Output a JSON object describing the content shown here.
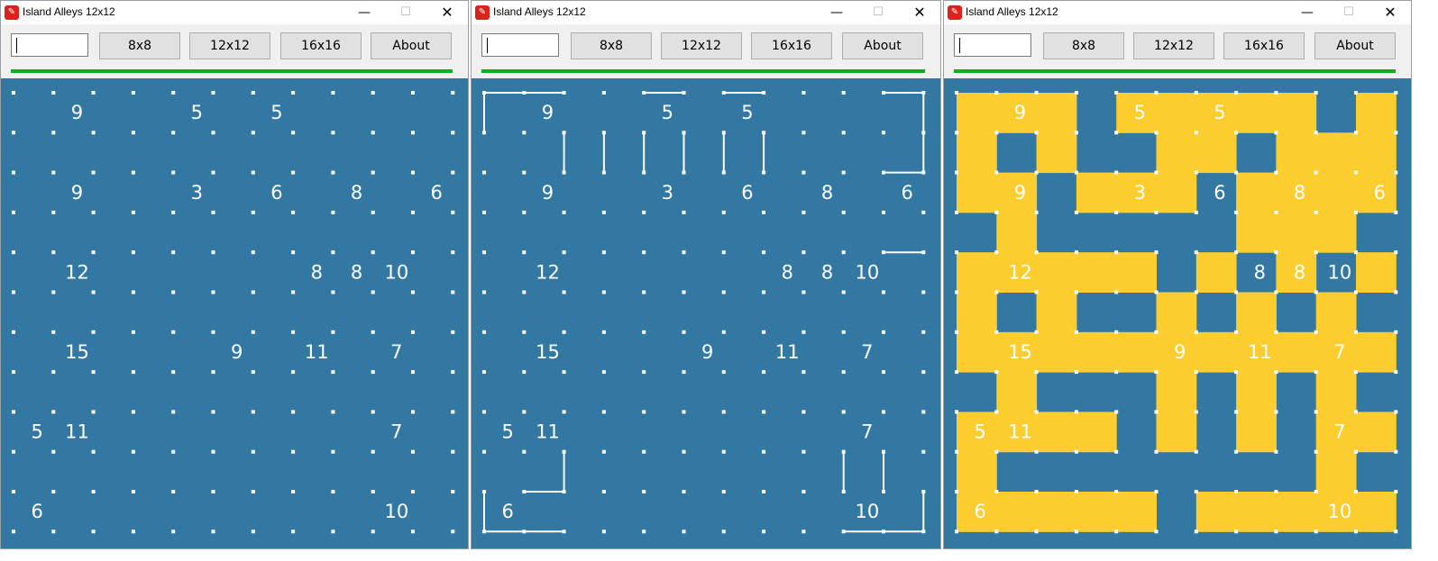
{
  "colors": {
    "board": "#3377a3",
    "island": "#fccd2f",
    "line": "#ffffff",
    "progress": "#06b025"
  },
  "clues": [
    {
      "r": 0,
      "c": 1,
      "v": "9"
    },
    {
      "r": 0,
      "c": 4,
      "v": "5"
    },
    {
      "r": 0,
      "c": 6,
      "v": "5"
    },
    {
      "r": 2,
      "c": 1,
      "v": "9"
    },
    {
      "r": 2,
      "c": 4,
      "v": "3"
    },
    {
      "r": 2,
      "c": 6,
      "v": "6"
    },
    {
      "r": 2,
      "c": 8,
      "v": "8"
    },
    {
      "r": 2,
      "c": 10,
      "v": "6"
    },
    {
      "r": 4,
      "c": 1,
      "v": "12"
    },
    {
      "r": 4,
      "c": 7,
      "v": "8"
    },
    {
      "r": 4,
      "c": 8,
      "v": "8"
    },
    {
      "r": 4,
      "c": 9,
      "v": "10"
    },
    {
      "r": 6,
      "c": 1,
      "v": "15"
    },
    {
      "r": 6,
      "c": 5,
      "v": "9"
    },
    {
      "r": 6,
      "c": 7,
      "v": "11"
    },
    {
      "r": 6,
      "c": 9,
      "v": "7"
    },
    {
      "r": 8,
      "c": 0,
      "v": "5"
    },
    {
      "r": 8,
      "c": 1,
      "v": "11"
    },
    {
      "r": 8,
      "c": 9,
      "v": "7"
    },
    {
      "r": 10,
      "c": 0,
      "v": "6"
    },
    {
      "r": 10,
      "c": 9,
      "v": "10"
    }
  ],
  "windows": [
    {
      "title": "Island Alleys 12x12",
      "controls": {
        "minimize": "—",
        "maximize": "☐",
        "close": "✕"
      },
      "input_value": "",
      "buttons": [
        "8x8",
        "12x12",
        "16x16",
        "About"
      ],
      "mode": "empty",
      "segments": []
    },
    {
      "title": "Island Alleys 12x12",
      "controls": {
        "minimize": "—",
        "maximize": "☐",
        "close": "✕"
      },
      "input_value": "",
      "buttons": [
        "8x8",
        "12x12",
        "16x16",
        "About"
      ],
      "mode": "partial",
      "segments": [
        [
          0,
          0,
          2,
          0
        ],
        [
          0,
          0,
          0,
          1
        ],
        [
          4,
          0,
          5,
          0
        ],
        [
          6,
          0,
          7,
          0
        ],
        [
          10,
          0,
          11,
          0
        ],
        [
          11,
          0,
          11,
          1
        ],
        [
          0,
          10,
          0,
          11
        ],
        [
          0,
          11,
          2,
          11
        ],
        [
          2,
          9,
          2,
          10
        ],
        [
          2,
          10,
          1,
          10
        ],
        [
          10,
          2,
          11,
          2
        ],
        [
          11,
          1,
          11,
          2
        ],
        [
          10,
          4,
          11,
          4
        ],
        [
          2,
          1,
          2,
          2
        ],
        [
          3,
          1,
          3,
          2
        ],
        [
          4,
          1,
          4,
          2
        ],
        [
          5,
          1,
          5,
          2
        ],
        [
          6,
          1,
          6,
          2
        ],
        [
          7,
          1,
          7,
          2
        ],
        [
          10,
          9,
          10,
          10
        ],
        [
          11,
          11,
          11,
          10
        ],
        [
          9,
          11,
          11,
          11
        ],
        [
          9,
          9,
          9,
          10
        ]
      ]
    },
    {
      "title": "Island Alleys 12x12",
      "controls": {
        "minimize": "—",
        "maximize": "☐",
        "close": "✕"
      },
      "input_value": "",
      "buttons": [
        "8x8",
        "12x12",
        "16x16",
        "About"
      ],
      "mode": "solved",
      "segments": [],
      "solution": [
        "XXO XXXXO X",
        "O X  OX XXO",
        "XX XXX XXXX",
        " X     XXX ",
        "XXXXX X X X",
        "X X  X X X ",
        "XXXXXXXXXXX",
        " X   X X X ",
        "XXXX X X XX",
        "X        X ",
        "XXXXX XXXXX"
      ]
    }
  ]
}
